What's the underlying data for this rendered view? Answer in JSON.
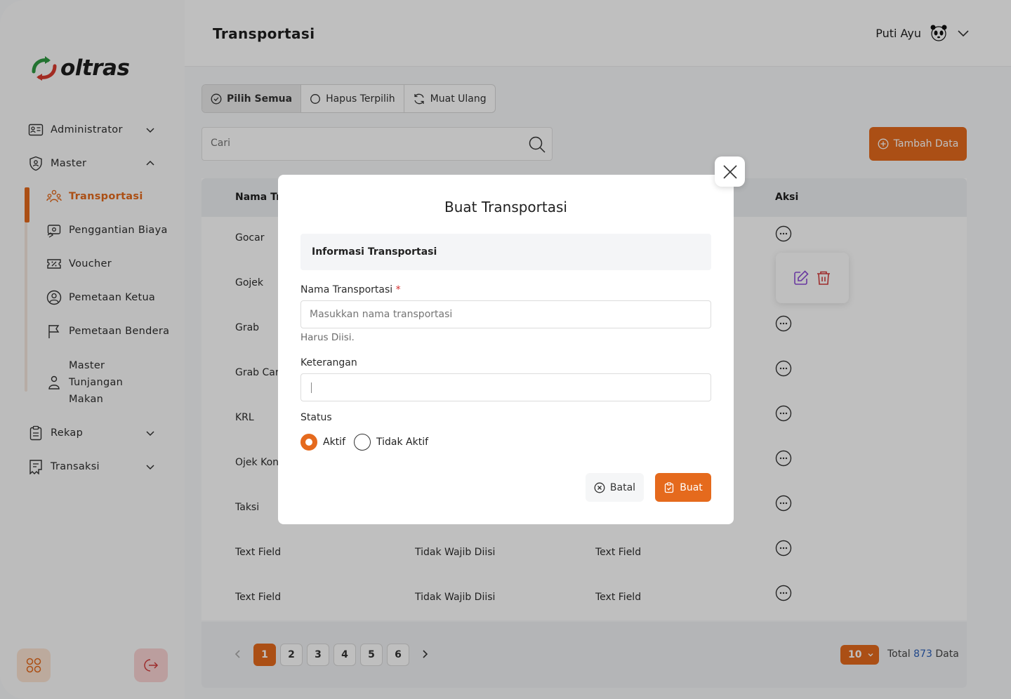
{
  "app": {
    "brand": "oltras",
    "page_title": "Transportasi",
    "user_name": "Puti Ayu"
  },
  "sidebar": {
    "items": [
      {
        "label": "Administrator",
        "icon": "id-card-icon"
      },
      {
        "label": "Master",
        "icon": "shield-icon"
      },
      {
        "label": "Rekap",
        "icon": "clipboard-icon"
      },
      {
        "label": "Transaksi",
        "icon": "receipt-icon"
      }
    ],
    "sub_items": [
      {
        "label": "Transportasi",
        "icon": "users-group-icon",
        "active": true
      },
      {
        "label": "Penggantian Biaya",
        "icon": "money-icon"
      },
      {
        "label": "Voucher",
        "icon": "ticket-icon"
      },
      {
        "label": "Pemetaan Ketua",
        "icon": "user-circle-icon"
      },
      {
        "label": "Pemetaan Bendera",
        "icon": "flag-icon"
      },
      {
        "label": "Master Tunjangan Makan",
        "icon": "person-icon"
      }
    ]
  },
  "toolbar": {
    "select_all": "Pilih Semua",
    "delete_selected": "Hapus Terpilih",
    "reload": "Muat Ulang"
  },
  "search": {
    "placeholder": "Cari"
  },
  "add_button": "Tambah Data",
  "table": {
    "headers": [
      "Nama Tr",
      "Aksi"
    ],
    "rows": [
      [
        "Gocar",
        "",
        ""
      ],
      [
        "Gojek",
        "",
        ""
      ],
      [
        "Grab",
        "",
        ""
      ],
      [
        "Grab Car",
        "",
        ""
      ],
      [
        "KRL",
        "",
        ""
      ],
      [
        "Ojek Konv",
        "",
        ""
      ],
      [
        "Taksi",
        "",
        ""
      ],
      [
        "Text Field",
        "Tidak Wajib Diisi",
        "Text Field"
      ],
      [
        "Text Field",
        "Tidak Wajib Diisi",
        "Text Field"
      ]
    ]
  },
  "pagination": {
    "pages": [
      "1",
      "2",
      "3",
      "4",
      "5",
      "6"
    ],
    "current": "1",
    "per_page": "10",
    "total_prefix": "Total",
    "total_count": "873",
    "total_suffix": "Data"
  },
  "modal": {
    "title": "Buat Transportasi",
    "section": "Informasi Transportasi",
    "name_label": "Nama Transportasi",
    "required_mark": "*",
    "name_placeholder": "Masukkan nama transportasi",
    "name_hint": "Harus Diisi.",
    "desc_label": "Keterangan",
    "status_label": "Status",
    "status_options": [
      "Aktif",
      "Tidak Aktif"
    ],
    "status_selected": "Aktif",
    "cancel": "Batal",
    "create": "Buat"
  },
  "colors": {
    "accent": "#e56a1d",
    "link_blue": "#2b5fb8",
    "action_purple": "#8c4bd6",
    "action_red": "#d23b3b"
  }
}
